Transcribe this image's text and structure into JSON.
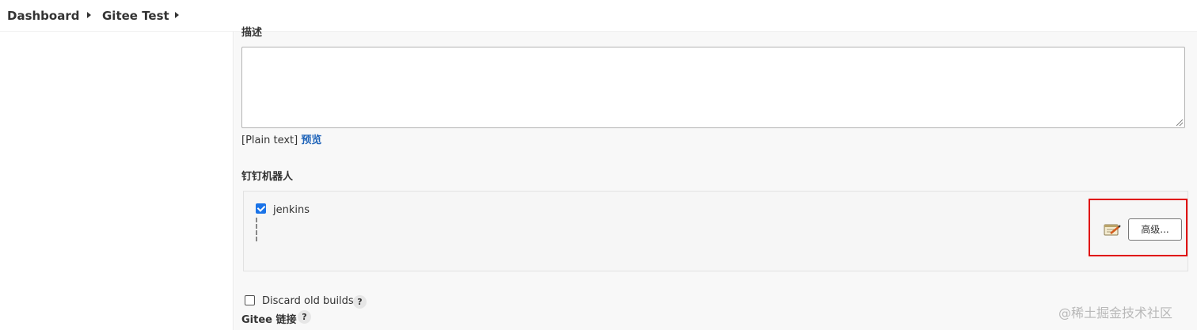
{
  "breadcrumb": {
    "items": [
      "Dashboard",
      "Gitee Test"
    ]
  },
  "description": {
    "label": "描述",
    "value": "",
    "format_label": "[Plain text]",
    "preview_link": "预览"
  },
  "dingtalk": {
    "label": "钉钉机器人",
    "robots": [
      {
        "name": "jenkins",
        "checked": true
      }
    ],
    "advanced_button": "高级..."
  },
  "discard_old_builds": {
    "label": "Discard old builds",
    "checked": false
  },
  "gitee_link": {
    "label": "Gitee 链接"
  },
  "help_glyph": "?",
  "watermark": "@稀土掘金技术社区",
  "colors": {
    "accent": "#1a73e8",
    "link": "#1f64b9",
    "highlight": "#e00000",
    "panel_bg": "#f8f8f8"
  },
  "icons": [
    "chevron-right-icon",
    "notepad-edit-icon",
    "help-icon",
    "resize-grip-icon"
  ]
}
